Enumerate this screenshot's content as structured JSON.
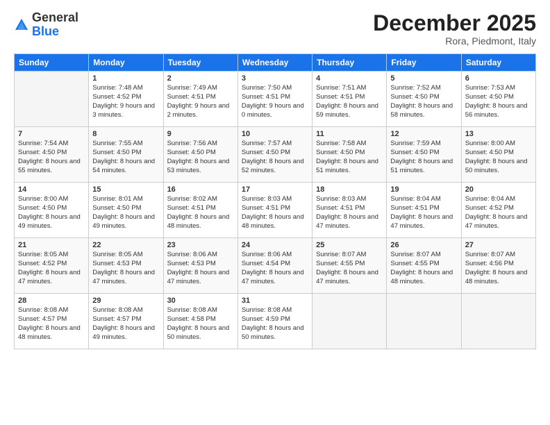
{
  "logo": {
    "general": "General",
    "blue": "Blue"
  },
  "title": "December 2025",
  "location": "Rora, Piedmont, Italy",
  "days_header": [
    "Sunday",
    "Monday",
    "Tuesday",
    "Wednesday",
    "Thursday",
    "Friday",
    "Saturday"
  ],
  "weeks": [
    [
      {
        "day": "",
        "sunrise": "",
        "sunset": "",
        "daylight": ""
      },
      {
        "day": "1",
        "sunrise": "Sunrise: 7:48 AM",
        "sunset": "Sunset: 4:52 PM",
        "daylight": "Daylight: 9 hours and 3 minutes."
      },
      {
        "day": "2",
        "sunrise": "Sunrise: 7:49 AM",
        "sunset": "Sunset: 4:51 PM",
        "daylight": "Daylight: 9 hours and 2 minutes."
      },
      {
        "day": "3",
        "sunrise": "Sunrise: 7:50 AM",
        "sunset": "Sunset: 4:51 PM",
        "daylight": "Daylight: 9 hours and 0 minutes."
      },
      {
        "day": "4",
        "sunrise": "Sunrise: 7:51 AM",
        "sunset": "Sunset: 4:51 PM",
        "daylight": "Daylight: 8 hours and 59 minutes."
      },
      {
        "day": "5",
        "sunrise": "Sunrise: 7:52 AM",
        "sunset": "Sunset: 4:50 PM",
        "daylight": "Daylight: 8 hours and 58 minutes."
      },
      {
        "day": "6",
        "sunrise": "Sunrise: 7:53 AM",
        "sunset": "Sunset: 4:50 PM",
        "daylight": "Daylight: 8 hours and 56 minutes."
      }
    ],
    [
      {
        "day": "7",
        "sunrise": "Sunrise: 7:54 AM",
        "sunset": "Sunset: 4:50 PM",
        "daylight": "Daylight: 8 hours and 55 minutes."
      },
      {
        "day": "8",
        "sunrise": "Sunrise: 7:55 AM",
        "sunset": "Sunset: 4:50 PM",
        "daylight": "Daylight: 8 hours and 54 minutes."
      },
      {
        "day": "9",
        "sunrise": "Sunrise: 7:56 AM",
        "sunset": "Sunset: 4:50 PM",
        "daylight": "Daylight: 8 hours and 53 minutes."
      },
      {
        "day": "10",
        "sunrise": "Sunrise: 7:57 AM",
        "sunset": "Sunset: 4:50 PM",
        "daylight": "Daylight: 8 hours and 52 minutes."
      },
      {
        "day": "11",
        "sunrise": "Sunrise: 7:58 AM",
        "sunset": "Sunset: 4:50 PM",
        "daylight": "Daylight: 8 hours and 51 minutes."
      },
      {
        "day": "12",
        "sunrise": "Sunrise: 7:59 AM",
        "sunset": "Sunset: 4:50 PM",
        "daylight": "Daylight: 8 hours and 51 minutes."
      },
      {
        "day": "13",
        "sunrise": "Sunrise: 8:00 AM",
        "sunset": "Sunset: 4:50 PM",
        "daylight": "Daylight: 8 hours and 50 minutes."
      }
    ],
    [
      {
        "day": "14",
        "sunrise": "Sunrise: 8:00 AM",
        "sunset": "Sunset: 4:50 PM",
        "daylight": "Daylight: 8 hours and 49 minutes."
      },
      {
        "day": "15",
        "sunrise": "Sunrise: 8:01 AM",
        "sunset": "Sunset: 4:50 PM",
        "daylight": "Daylight: 8 hours and 49 minutes."
      },
      {
        "day": "16",
        "sunrise": "Sunrise: 8:02 AM",
        "sunset": "Sunset: 4:51 PM",
        "daylight": "Daylight: 8 hours and 48 minutes."
      },
      {
        "day": "17",
        "sunrise": "Sunrise: 8:03 AM",
        "sunset": "Sunset: 4:51 PM",
        "daylight": "Daylight: 8 hours and 48 minutes."
      },
      {
        "day": "18",
        "sunrise": "Sunrise: 8:03 AM",
        "sunset": "Sunset: 4:51 PM",
        "daylight": "Daylight: 8 hours and 47 minutes."
      },
      {
        "day": "19",
        "sunrise": "Sunrise: 8:04 AM",
        "sunset": "Sunset: 4:51 PM",
        "daylight": "Daylight: 8 hours and 47 minutes."
      },
      {
        "day": "20",
        "sunrise": "Sunrise: 8:04 AM",
        "sunset": "Sunset: 4:52 PM",
        "daylight": "Daylight: 8 hours and 47 minutes."
      }
    ],
    [
      {
        "day": "21",
        "sunrise": "Sunrise: 8:05 AM",
        "sunset": "Sunset: 4:52 PM",
        "daylight": "Daylight: 8 hours and 47 minutes."
      },
      {
        "day": "22",
        "sunrise": "Sunrise: 8:05 AM",
        "sunset": "Sunset: 4:53 PM",
        "daylight": "Daylight: 8 hours and 47 minutes."
      },
      {
        "day": "23",
        "sunrise": "Sunrise: 8:06 AM",
        "sunset": "Sunset: 4:53 PM",
        "daylight": "Daylight: 8 hours and 47 minutes."
      },
      {
        "day": "24",
        "sunrise": "Sunrise: 8:06 AM",
        "sunset": "Sunset: 4:54 PM",
        "daylight": "Daylight: 8 hours and 47 minutes."
      },
      {
        "day": "25",
        "sunrise": "Sunrise: 8:07 AM",
        "sunset": "Sunset: 4:55 PM",
        "daylight": "Daylight: 8 hours and 47 minutes."
      },
      {
        "day": "26",
        "sunrise": "Sunrise: 8:07 AM",
        "sunset": "Sunset: 4:55 PM",
        "daylight": "Daylight: 8 hours and 48 minutes."
      },
      {
        "day": "27",
        "sunrise": "Sunrise: 8:07 AM",
        "sunset": "Sunset: 4:56 PM",
        "daylight": "Daylight: 8 hours and 48 minutes."
      }
    ],
    [
      {
        "day": "28",
        "sunrise": "Sunrise: 8:08 AM",
        "sunset": "Sunset: 4:57 PM",
        "daylight": "Daylight: 8 hours and 48 minutes."
      },
      {
        "day": "29",
        "sunrise": "Sunrise: 8:08 AM",
        "sunset": "Sunset: 4:57 PM",
        "daylight": "Daylight: 8 hours and 49 minutes."
      },
      {
        "day": "30",
        "sunrise": "Sunrise: 8:08 AM",
        "sunset": "Sunset: 4:58 PM",
        "daylight": "Daylight: 8 hours and 50 minutes."
      },
      {
        "day": "31",
        "sunrise": "Sunrise: 8:08 AM",
        "sunset": "Sunset: 4:59 PM",
        "daylight": "Daylight: 8 hours and 50 minutes."
      },
      {
        "day": "",
        "sunrise": "",
        "sunset": "",
        "daylight": ""
      },
      {
        "day": "",
        "sunrise": "",
        "sunset": "",
        "daylight": ""
      },
      {
        "day": "",
        "sunrise": "",
        "sunset": "",
        "daylight": ""
      }
    ]
  ]
}
